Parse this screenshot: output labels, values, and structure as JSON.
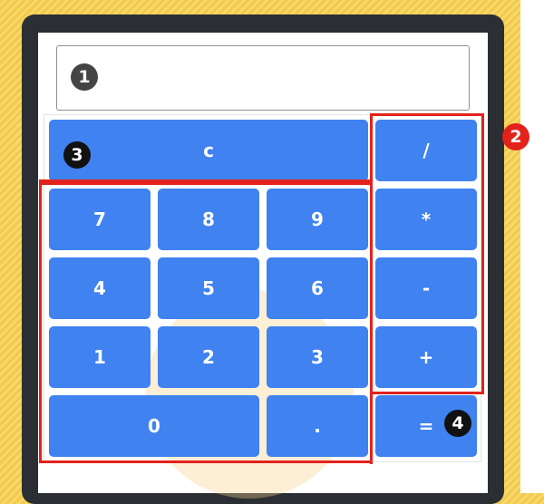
{
  "display": {
    "value": ""
  },
  "buttons": {
    "clear": "c",
    "divide": "/",
    "multiply": "*",
    "minus": "-",
    "plus": "+",
    "equals": "=",
    "seven": "7",
    "eight": "8",
    "nine": "9",
    "four": "4",
    "five": "5",
    "six": "6",
    "one": "1",
    "two": "2",
    "three": "3",
    "zero": "0",
    "dot": "."
  },
  "annotations": {
    "badge_1": "1",
    "badge_2": "2",
    "badge_3": "3",
    "badge_4": "4"
  },
  "colors": {
    "button": "#3f82f0",
    "highlight": "#e3221c",
    "background": "#f2c94c",
    "phone_frame": "#2b2f33"
  }
}
